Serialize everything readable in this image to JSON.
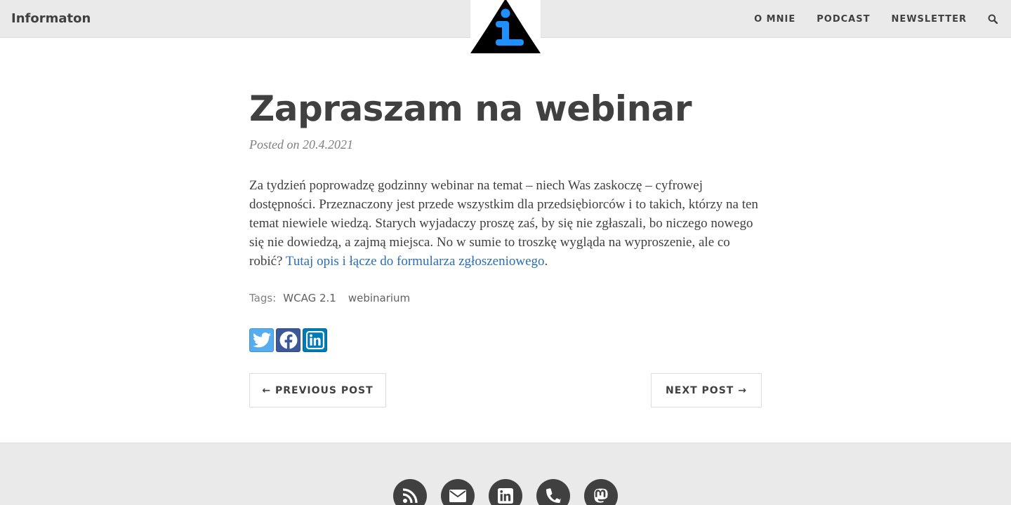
{
  "navbar": {
    "brand": "Informaton",
    "links": [
      {
        "label": "O MNIE"
      },
      {
        "label": "PODCAST"
      },
      {
        "label": "NEWSLETTER"
      }
    ],
    "search_icon": "search-icon"
  },
  "logo": {
    "icon": "info-triangle-logo",
    "colors": {
      "triangle": "#000000",
      "letter": "#1e90ff"
    }
  },
  "post": {
    "title": "Zapraszam na webinar",
    "meta": "Posted on 20.4.2021",
    "body_text": "Za tydzień poprowadzę godzinny webinar na temat – niech Was zaskoczę – cyfrowej dostępności. Przeznaczony jest przede wszystkim dla przedsiębiorców i to takich, którzy na ten temat niewiele wiedzą. Starych wyjadaczy proszę zaś, by się nie zgłaszali, bo niczego nowego się nie dowiedzą, a zajmą miejsca. No w sumie to troszkę wygląda na wyproszenie, ale co robić? ",
    "link_text": "Tutaj opis i łącze do formularza zgłoszeniowego",
    "after_link": ".",
    "tags_label": "Tags:",
    "tags": [
      "WCAG 2.1",
      "webinarium"
    ]
  },
  "share": [
    {
      "icon": "twitter-icon",
      "color": "#55acee"
    },
    {
      "icon": "facebook-icon",
      "color": "#3b5998"
    },
    {
      "icon": "linkedin-icon",
      "color": "#007bb5"
    }
  ],
  "pager": {
    "previous": "← PREVIOUS POST",
    "next": "NEXT POST →"
  },
  "footer": {
    "icons": [
      "rss-icon",
      "email-icon",
      "linkedin-icon",
      "phone-icon",
      "mastodon-icon"
    ],
    "icon_bg": "#404040"
  }
}
